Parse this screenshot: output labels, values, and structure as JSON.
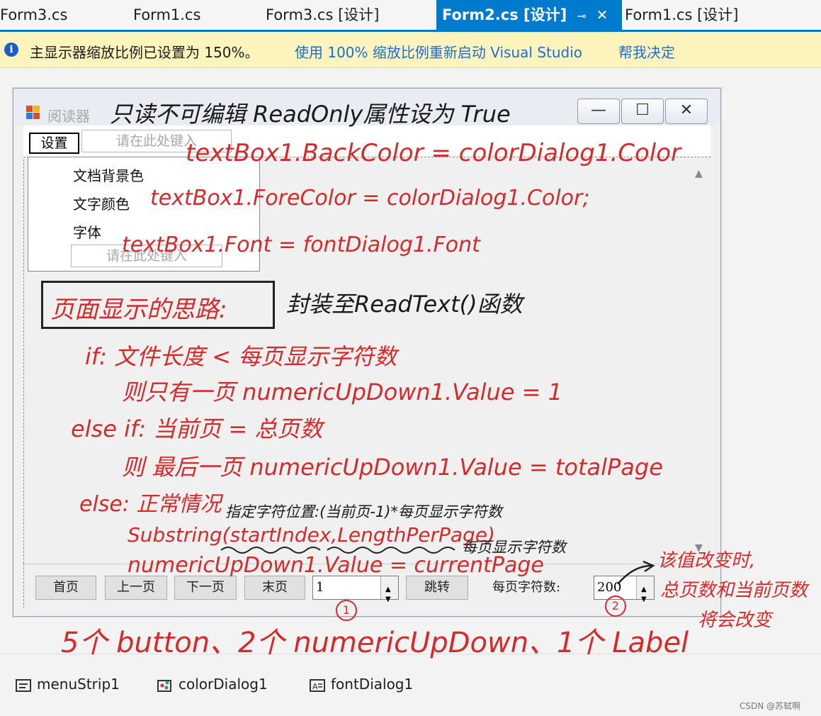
{
  "tabs": [
    {
      "label": "Form3.cs"
    },
    {
      "label": "Form1.cs"
    },
    {
      "label": "Form3.cs [设计]"
    },
    {
      "label": "Form2.cs [设计]",
      "active": true
    },
    {
      "label": "Form1.cs [设计]"
    }
  ],
  "tab_pin_glyph": "⊸",
  "tab_close_glyph": "✕",
  "infobar": {
    "icon": "info-icon",
    "message": "主显示器缩放比例已设置为 150%。",
    "restart_link": "使用 100% 缩放比例重新启动 Visual Studio",
    "decide_link": "帮我决定"
  },
  "form": {
    "title": "阅读器",
    "minimize_glyph": "—",
    "maximize_glyph": "☐",
    "close_glyph": "✕",
    "menu": {
      "settings": "设置",
      "type_here": "请在此处键入",
      "dropdown": [
        "文档背景色",
        "文字颜色",
        "字体"
      ],
      "dropdown_type_here": "请在此处键入"
    },
    "buttons": {
      "first": "首页",
      "prev": "上一页",
      "next": "下一页",
      "last": "末页",
      "jump": "跳转"
    },
    "page_numeric_value": "1",
    "chars_label": "每页字符数:",
    "chars_numeric_value": "200"
  },
  "tray": [
    "menuStrip1",
    "colorDialog1",
    "fontDialog1"
  ],
  "watermark": "CSDN @苏轼啊",
  "annotations": {
    "readonly": "只读不可编辑 ReadOnly属性设为 True",
    "backcolor": "textBox1.BackColor = colorDialog1.Color",
    "forecolor": "textBox1.ForeColor = colorDialog1.Color;",
    "font": "textBox1.Font = fontDialog1.Font",
    "idea_box": "页面显示的思路:",
    "encapsulate": "封装至ReadText()函数",
    "if_line": "if: 文件长度 < 每页显示字符数",
    "if_then": "则只有一页 numericUpDown1.Value = 1",
    "elseif_line": "else if: 当前页 = 总页数",
    "elseif_then": "则 最后一页 numericUpDown1.Value = totalPage",
    "else_line": "else: 正常情况",
    "start_note": "指定字符位置:(当前页-1)*每页显示字符数",
    "substring": "Substring(startIndex,LengthPerPage)",
    "length_note": "每页显示字符数",
    "current_page": "numericUpDown1.Value = currentPage",
    "circle1": "1",
    "circle2": "2",
    "change_note_1": "该值改变时,",
    "change_note_2": "总页数和当前页数",
    "change_note_3": "将会改变",
    "summary": "5个 button、2个 numericUpDown、1个 Label"
  }
}
